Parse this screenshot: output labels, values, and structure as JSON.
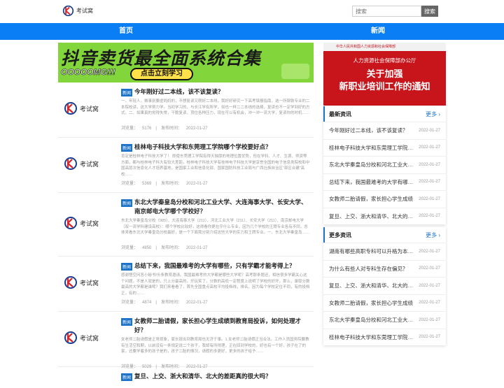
{
  "header": {
    "logo_text": "考试窝",
    "search_placeholder": "搜索",
    "search_button": "搜索"
  },
  "nav": [
    {
      "label": "首页"
    },
    {
      "label": "新闻"
    }
  ],
  "banner": {
    "title": "抖音卖货最全面系统合集",
    "tagline": "OOOOOMG!!!",
    "cta": "点击立刻学习"
  },
  "articles": [
    {
      "badge": "新闻",
      "thumb_text": "考试窝",
      "title": "今年刚好过二本线，该不该复读？",
      "excerpt": "一、年轻人，做事别要虚妈妈的，不想复读又刚好二本线，我好好研究一下高考填报指南，选一所钢铁专业的二本院校读，这大学努力学。当初学习的，与长江学有所学，如也一样二二本线的选择，复读也不一定学到好的方式。二、如果真的觉得失常，干脆复读，顶住各种压力，现在可以有机会，冲一冲一流大学，复读你的时机……",
      "views_label": "浏览量：",
      "views": "5176",
      "date_label": "发布时间：",
      "date": "2022-01-27"
    },
    {
      "badge": "新闻",
      "thumb_text": "考试窝",
      "title": "桂林电子科技大学和东莞理工学院哪个学校要好点？",
      "excerpt": "肯定是桂林电子科技大学了！ 即使东莞理工学院有得天独厚的地理位置优势，但在学科、人才、生源、师资等方面，都与桂林电子科大有较大差距。桂林电子科技大学有桂林电子科技大学是享誉全国的电子信息类院校和中国高层次信息化人才培养基地，是国家工业和信息化部、国家国防科技工业局与广西壮族自治区“部区合建”高校……",
      "views_label": "浏览量：",
      "views": "5369",
      "date_label": "发布时间：",
      "date": "2022-01-27"
    },
    {
      "badge": "新闻",
      "thumb_text": "考试窝",
      "title": "东北大学秦皇岛分校和河北工业大学、大连海事大学、长安大学、南京邮电大学哪个学校好？",
      "excerpt": "东北大学秦皇岛分校（985）、大连海事大学（211）、河北工业大学（211）、长安大学（211）、南京邮电大学（双一流学科建设高校）：哪个学校比较好，这得看你更在乎什么专业，因为几个学校的王牌专业各有不同，总体来看东北大学秦皇岛分校最好，是一个下面我分别介绍这些大学的实力和王牌专业。一、东北大学秦皇岛……",
      "views_label": "浏览量：",
      "views": "4850",
      "date_label": "发布时间：",
      "date": "2022-01-27"
    },
    {
      "badge": "新闻",
      "thumb_text": "考试窝",
      "title": "总结下来，我国最难考的大学有哪些，只有学霸才能考得上？",
      "excerpt": "感谢悟空问答小秘书/头条教育邀请。我国最难考的大学都是哪些大学呢？高考那条题还，相信很多学霸关心这个问题，不是人就是的，只上分最高的，开玩笑了，分数的高低一定程度上说明了学校的好坏，那么，录取分数最高的大学都是谁呢？我们来看看了，首先全国重点高校平均投档线，排名，因为每个学校定位不同，有的投档正，有的……",
      "views_label": "浏览量：",
      "views": "4874",
      "date_label": "发布时间：",
      "date": "2022-01-27"
    },
    {
      "badge": "新闻",
      "thumb_text": "考试窝",
      "title": "女教师二胎请假，家长担心学生成绩到教育局投诉，如何处理才好？",
      "excerpt": "女老师二胎请假是正常现象，家长提出到教育局也无济于事。1.女老师二胎请假正当合法。工作人员国务院要教有生活空和期，以前没有一条规定说二个孩子，我却有所得理，正在回到学校的，好也有一个好，孩子在了的家，还要学着多的孩子是的，孩子二胎的情况，请假的多更好，更多的孩子给予……",
      "views_label": "浏览量：",
      "views": "5029",
      "date_label": "发布时间：",
      "date": "2022-01-27"
    },
    {
      "badge": "新闻",
      "thumb_text": "考试窝",
      "title": "复旦、上交、浙大和清华、北大的差距真的很大吗？",
      "excerpt": "",
      "views_label": "",
      "views": "",
      "date_label": "",
      "date": ""
    }
  ],
  "side_banner": {
    "org": "中华人民共和国人力资源和社会保障部",
    "sub": "人力资源社会保障部办公厅",
    "line1": "关于加强",
    "line2": "新职业培训工作的通知"
  },
  "latest": {
    "title": "最新资讯",
    "more": "更多 ›",
    "items": [
      {
        "text": "今年刚好过二本线，该不该复读？",
        "date": "2022-01-27"
      },
      {
        "text": "桂林电子科技大学和东莞理工学院哪个学校要好点？",
        "date": "2022-01-27"
      },
      {
        "text": "东北大学秦皇岛分校和河北工业大学哪个学校好？",
        "date": "2022-01-27"
      },
      {
        "text": "总结下来，我国最难考的大学有哪些？",
        "date": "2022-01-27"
      },
      {
        "text": "女教师二胎请假，家长担心学生成绩",
        "date": "2022-01-27"
      },
      {
        "text": "复旦、上交、浙大和清华、北大的差距真的很大吗？",
        "date": "2022-01-27"
      }
    ]
  },
  "more_news": {
    "title": "更多资讯",
    "more": "更多 ›",
    "items": [
      {
        "text": "湖南有哪些高职专科可以升格为本科？",
        "date": "2022-01-27"
      },
      {
        "text": "为什么有些人对专科生存在偏见？",
        "date": "2022-01-27"
      },
      {
        "text": "复旦、上交、浙大和清华、北大的差距真的很大吗？",
        "date": "2022-01-27"
      },
      {
        "text": "女教师二胎请假，家长担心学生成绩",
        "date": "2022-01-27"
      },
      {
        "text": "东北大学秦皇岛分校和河北工业大学哪个学校好？",
        "date": "2022-01-27"
      },
      {
        "text": "桂林电子科技大学和东莞理工学院哪个学校要好点？",
        "date": "2022-01-27"
      }
    ]
  },
  "colors": {
    "nav": "#0a7ff5",
    "badge": "#1a73c8",
    "banner": "#82d63c",
    "side_banner": "#c8141b"
  }
}
